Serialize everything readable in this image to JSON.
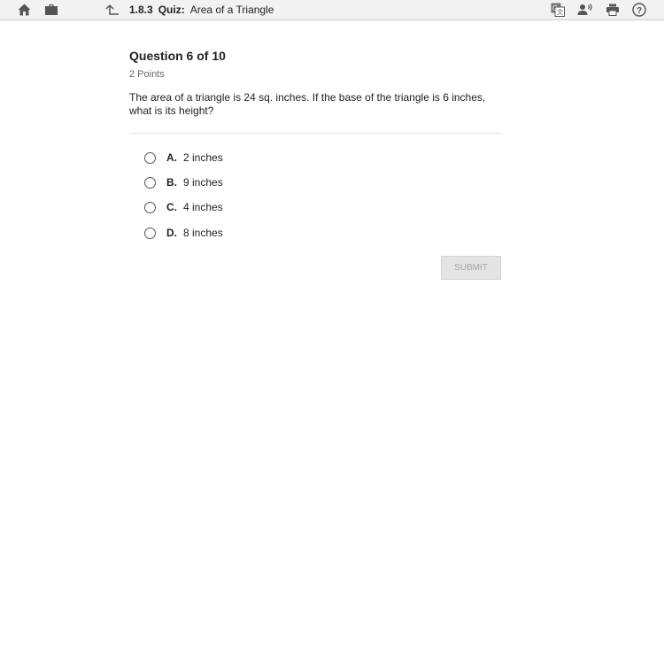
{
  "topbar": {
    "quiz_number": "1.8.3",
    "quiz_kind": "Quiz:",
    "quiz_name": "Area of a Triangle",
    "icons": [
      "home-icon",
      "briefcase-icon",
      "back-arrow-icon",
      "translate-icon",
      "text-to-speech-icon",
      "print-icon",
      "help-icon"
    ],
    "icon_color": "#555555"
  },
  "question": {
    "title": "Question 6 of 10",
    "points": "2 Points",
    "text": "The area of a triangle is 24 sq. inches. If the base of the triangle is 6 inches, what is its height?"
  },
  "choices": [
    {
      "letter": "A.",
      "text": "2 inches"
    },
    {
      "letter": "B.",
      "text": "9 inches"
    },
    {
      "letter": "C.",
      "text": "4 inches"
    },
    {
      "letter": "D.",
      "text": "8 inches"
    }
  ],
  "submit_label": "SUBMIT"
}
